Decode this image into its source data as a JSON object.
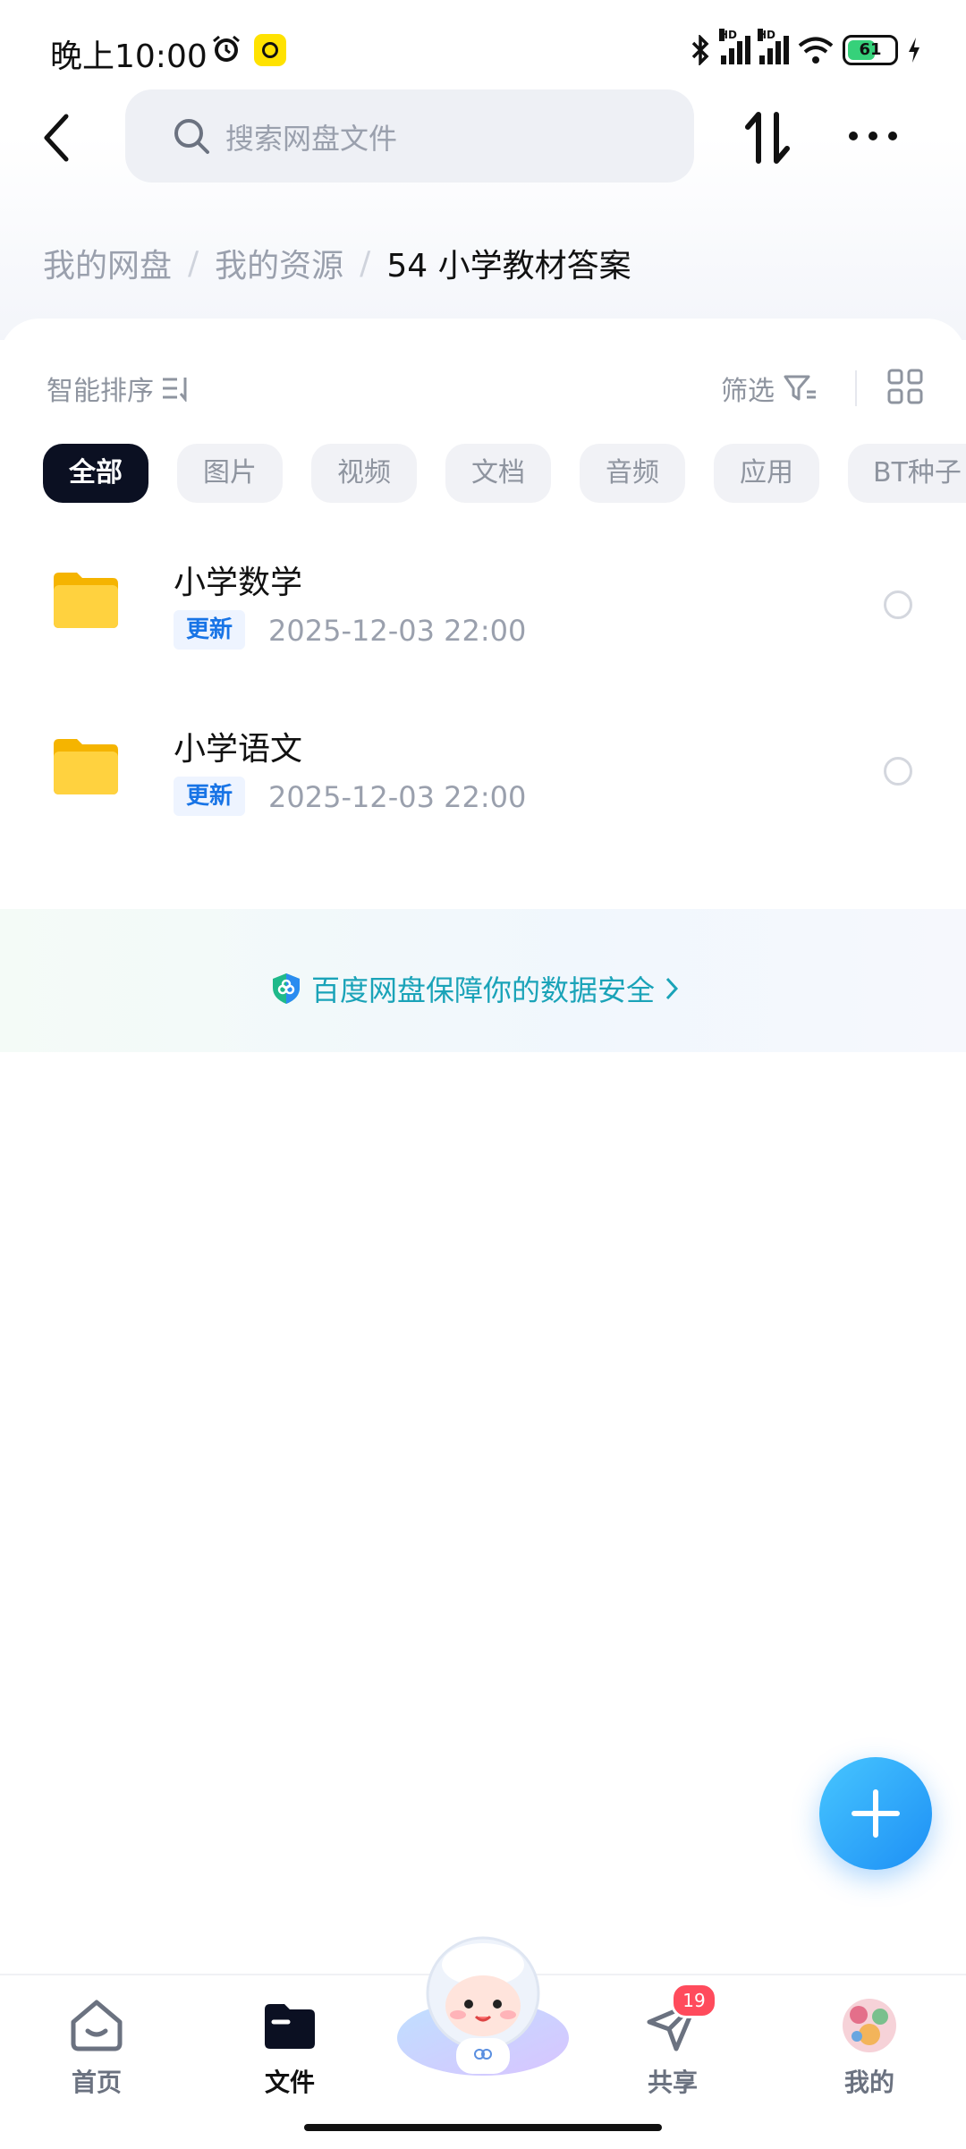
{
  "status_bar": {
    "time": "晚上10:00",
    "battery": "61",
    "signal_label": "HD"
  },
  "header": {
    "search_placeholder": "搜索网盘文件"
  },
  "breadcrumb": {
    "items": [
      "我的网盘",
      "我的资源"
    ],
    "separator": "/",
    "current": "54 小学教材答案"
  },
  "toolbar": {
    "sort_label": "智能排序",
    "filter_label": "筛选"
  },
  "tabs": [
    {
      "label": "全部",
      "active": true
    },
    {
      "label": "图片",
      "active": false
    },
    {
      "label": "视频",
      "active": false
    },
    {
      "label": "文档",
      "active": false
    },
    {
      "label": "音频",
      "active": false
    },
    {
      "label": "应用",
      "active": false
    },
    {
      "label": "BT种子",
      "active": false
    }
  ],
  "files": [
    {
      "name": "小学数学",
      "tag": "更新",
      "date": "2025-12-03   22:00"
    },
    {
      "name": "小学语文",
      "tag": "更新",
      "date": "2025-12-03   22:00"
    }
  ],
  "security_banner": {
    "text": "百度网盘保障你的数据安全"
  },
  "bottom_nav": {
    "items": [
      {
        "label": "首页",
        "active": false
      },
      {
        "label": "文件",
        "active": true
      },
      {
        "label": "",
        "active": false
      },
      {
        "label": "共享",
        "active": false,
        "badge": "19"
      },
      {
        "label": "我的",
        "active": false
      }
    ]
  },
  "colors": {
    "accent": "#1d8ff5",
    "tab_active_bg": "#0b1022",
    "folder": "#ffc61a",
    "secure_text": "#1aa3b8",
    "badge": "#ff4b5c"
  }
}
